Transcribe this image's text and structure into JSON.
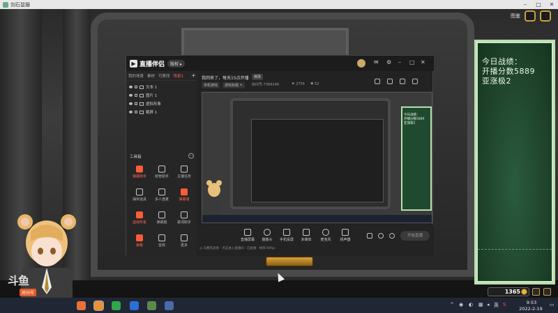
{
  "outer_window": {
    "title": "剑石鼠猫",
    "minimize": "–",
    "maximize": "□",
    "close": "✕"
  },
  "game_hud": {
    "top_right_label": "图鉴",
    "currency_value": "1365"
  },
  "scoreboard": {
    "line1": "今日战绩：",
    "line2": "开播分数5889",
    "line3": "亚涨极2"
  },
  "stream_app": {
    "logo": "直播伴侣",
    "version_badge": "版权 ▸",
    "tabs": [
      "我的场景",
      "素材",
      "可更改",
      "场景1"
    ],
    "active_tab_index": 3,
    "add_tab": "+",
    "sources": [
      {
        "label": "文本 1"
      },
      {
        "label": "图片 1"
      },
      {
        "label": "虚拟形象"
      },
      {
        "label": "截屏 1"
      }
    ],
    "tools_title": "工具箱",
    "tools_more": "⋯",
    "tools": [
      {
        "label": "弹幕助手",
        "hot": true
      },
      {
        "label": "房管助手",
        "hot": false
      },
      {
        "label": "主播任务",
        "hot": false
      },
      {
        "label": "抽奖道具",
        "hot": false
      },
      {
        "label": "多人连麦",
        "hot": false
      },
      {
        "label": "弹幕墙",
        "hot": true
      },
      {
        "label": "虚拟形象",
        "hot": true
      },
      {
        "label": "弹幕姬",
        "hot": false
      },
      {
        "label": "歌词助手",
        "hot": false
      },
      {
        "label": "弹幕",
        "hot": false
      },
      {
        "label": "音效",
        "hot": false
      },
      {
        "label": "更多",
        "hot": false
      }
    ],
    "live_title": "我回来了，每天15点开播",
    "edit_badge": "修改",
    "tags": [
      "单机游戏",
      "游戏标题 ✎"
    ],
    "info_room": "房间号:7366248",
    "info_fans": "⚑ 2756",
    "info_gift": "♥ 52",
    "controls": [
      {
        "label": "直播屏幕"
      },
      {
        "label": "摄像头"
      },
      {
        "label": "手机投屏"
      },
      {
        "label": "多媒体"
      },
      {
        "label": "麦克风"
      },
      {
        "label": "扬声器"
      }
    ],
    "start_button": "开始直播",
    "status_line": "◎ 马赛克表情  ·  点击进入直播间  ·  已就绪  ·  帧率:60fps",
    "preview_board_text": "今日战绩：\n开播分数5889\n亚涨极2"
  },
  "streamer": {
    "platform_logo": "斗鱼",
    "badge": "房间号",
    "room_number": "7366248"
  },
  "taskbar": {
    "tray_ime": "英",
    "time": "9:53",
    "date": "2022-2-19"
  },
  "colors": {
    "accent": "#ff5b3a",
    "board_green": "#1f4a30",
    "board_frame": "#b9dfb0"
  }
}
